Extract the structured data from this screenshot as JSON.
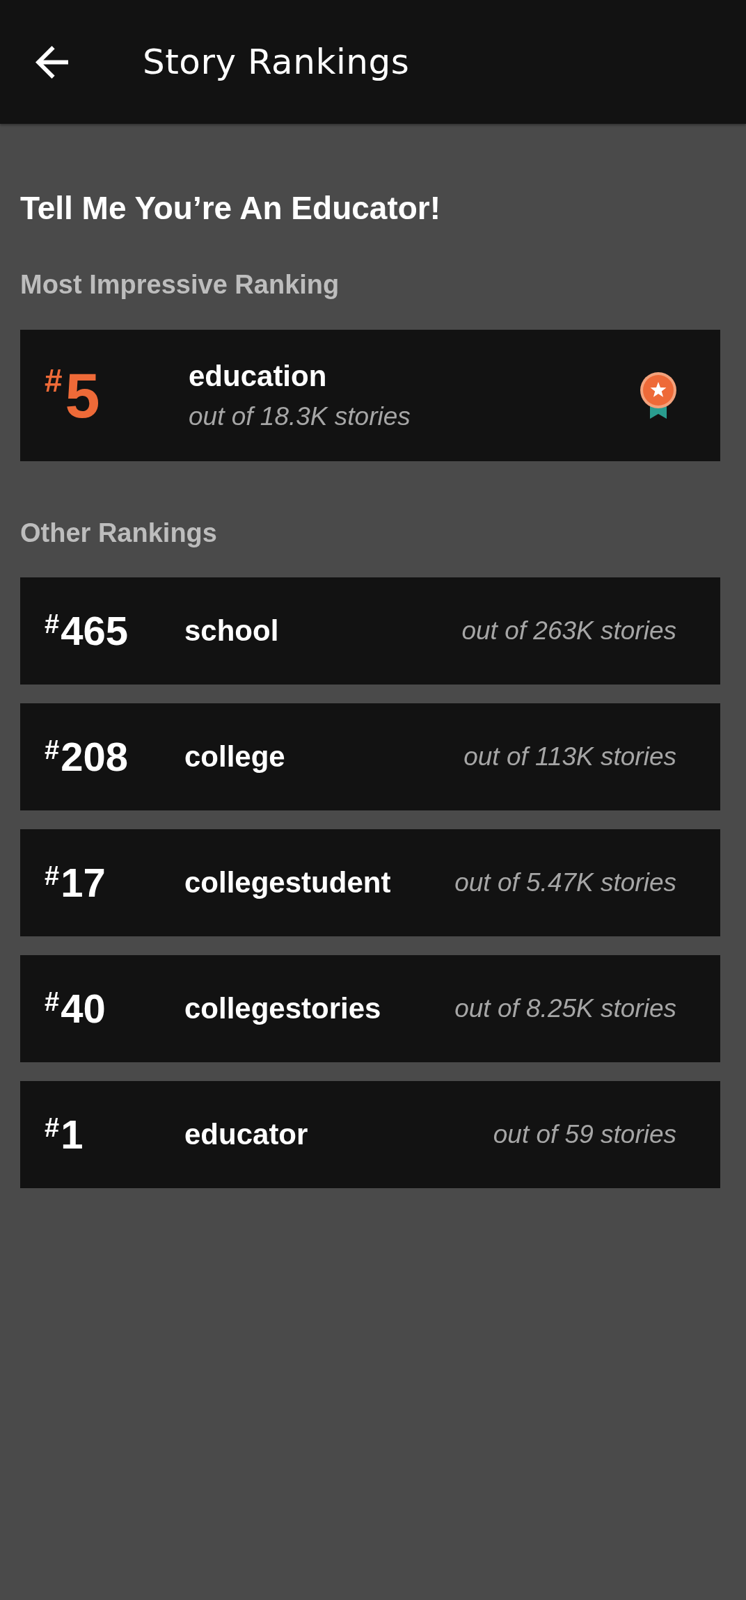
{
  "app_bar": {
    "title": "Story Rankings"
  },
  "story": {
    "title": "Tell Me You’re An Educator!"
  },
  "top_ranking": {
    "heading": "Most Impressive Ranking",
    "rank": "$^{#}$5",
    "tag": "education",
    "count": "out of 18.3K stories"
  },
  "other_rankings": {
    "heading": "Other Rankings",
    "rows": [
      {
        "rank": "$^{#}$465",
        "tag": "school",
        "count": "out of 263K stories"
      },
      {
        "rank": "$^{#}$208",
        "tag": "college",
        "count": "out of 113K stories"
      },
      {
        "rank": "$^{#}$17",
        "tag": "collegestudent",
        "count": "out of 5.47K stories"
      },
      {
        "rank": "$^{#}$40",
        "tag": "collegestories",
        "count": "out of 8.25K stories"
      },
      {
        "rank": "$^{#}$1",
        "tag": "educator",
        "count": "out of 59 stories"
      }
    ]
  }
}
